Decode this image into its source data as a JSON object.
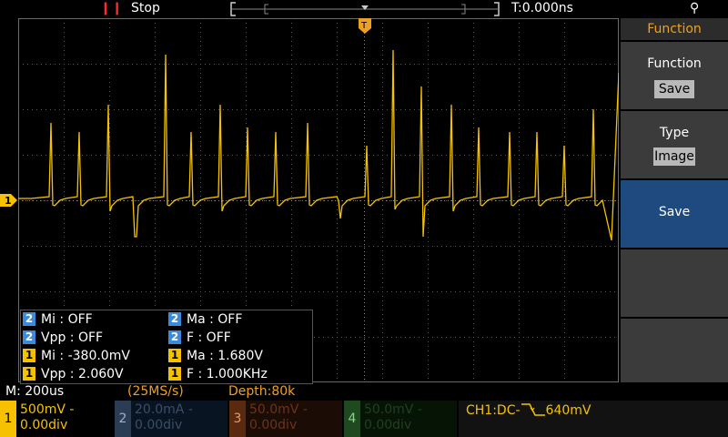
{
  "status_bar": {
    "run_icon": "pause-bars-icon",
    "run_status": "Stop",
    "time_offset": "T:0.000ns",
    "usb_icon": "usb-icon"
  },
  "waveform": {
    "color": "#f6c200",
    "channel_marker": "1",
    "trigger_marker": "T"
  },
  "measurements": {
    "rows": [
      {
        "ch": "2",
        "label": "Mi : OFF",
        "color": "#3d8ad9"
      },
      {
        "ch": "2",
        "label": "Ma : OFF",
        "color": "#3d8ad9"
      },
      {
        "ch": "2",
        "label": "Vpp : OFF",
        "color": "#3d8ad9"
      },
      {
        "ch": "2",
        "label": "F : OFF",
        "color": "#3d8ad9"
      },
      {
        "ch": "1",
        "label": "Mi : -380.0mV",
        "color": "#f6c200"
      },
      {
        "ch": "1",
        "label": "Ma : 1.680V",
        "color": "#f6c200"
      },
      {
        "ch": "1",
        "label": "Vpp : 2.060V",
        "color": "#f6c200"
      },
      {
        "ch": "1",
        "label": "F : 1.000KHz",
        "color": "#f6c200"
      }
    ]
  },
  "info_line": {
    "timebase": "M: 200us",
    "sample_rate": "(25MS/s)",
    "depth": "Depth:80k"
  },
  "channels": [
    {
      "num": "1",
      "line1": "500mV -",
      "line2": "0.00div"
    },
    {
      "num": "2",
      "line1": "20.0mA -",
      "line2": "0.00div"
    },
    {
      "num": "3",
      "line1": "50.0mV -",
      "line2": "0.00div"
    },
    {
      "num": "4",
      "line1": "50.0mV -",
      "line2": "0.00div"
    }
  ],
  "trigger": {
    "prefix": "CH1:DC-",
    "slope_icon": "falling-edge-icon",
    "level": "640mV"
  },
  "menu": {
    "title": "Function",
    "items": [
      {
        "label": "Function",
        "value": "Save"
      },
      {
        "label": "Type",
        "value": "Image"
      },
      {
        "label": "Save",
        "value": ""
      },
      {
        "label": "",
        "value": ""
      },
      {
        "label": "",
        "value": ""
      }
    ]
  }
}
